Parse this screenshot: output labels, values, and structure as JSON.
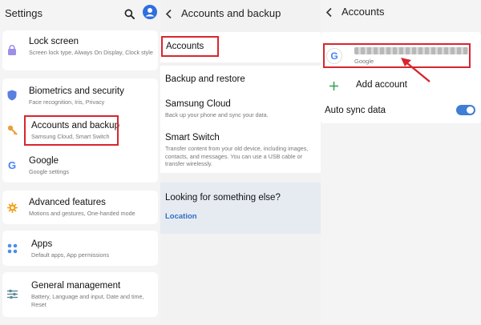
{
  "settings": {
    "title": "Settings",
    "items": [
      {
        "icon": "lock-icon",
        "label": "Lock screen",
        "sub": "Screen lock type, Always On Display, Clock style",
        "color": "#9b8fe8"
      },
      {
        "icon": "shield-icon",
        "label": "Biometrics and security",
        "sub": "Face recognition, Iris, Privacy",
        "color": "#5a7fe0"
      },
      {
        "icon": "key-icon",
        "label": "Accounts and backup",
        "sub": "Samsung Cloud, Smart Switch",
        "color": "#e7a23b"
      },
      {
        "icon": "google-g-icon",
        "label": "Google",
        "sub": "Google settings",
        "color": "#4285f4"
      },
      {
        "icon": "advanced-features-icon",
        "label": "Advanced features",
        "sub": "Motions and gestures, One-handed mode",
        "color": "#f0a31d"
      },
      {
        "icon": "apps-grid-icon",
        "label": "Apps",
        "sub": "Default apps, App permissions",
        "color": "#4d8ee8"
      },
      {
        "icon": "sliders-icon",
        "label": "General management",
        "sub": "Battery, Language and input, Date and time, Reset",
        "color": "#5b8a99"
      }
    ]
  },
  "accounts_backup": {
    "title": "Accounts and backup",
    "accounts_label": "Accounts",
    "backup_restore_label": "Backup and restore",
    "samsung_cloud_label": "Samsung Cloud",
    "samsung_cloud_sub": "Back up your phone and sync your data.",
    "smart_switch_label": "Smart Switch",
    "smart_switch_sub": "Transfer content from your old device, including images, contacts, and messages. You can use a USB cable or transfer wirelessly.",
    "looking_label": "Looking for something else?",
    "location_link": "Location"
  },
  "accounts": {
    "title": "Accounts",
    "account_sub": "Google",
    "add_account_label": "Add account",
    "auto_sync_label": "Auto sync data",
    "auto_sync_on": true
  },
  "colors": {
    "highlight": "#d8262e",
    "accent": "#3f7dd6"
  }
}
